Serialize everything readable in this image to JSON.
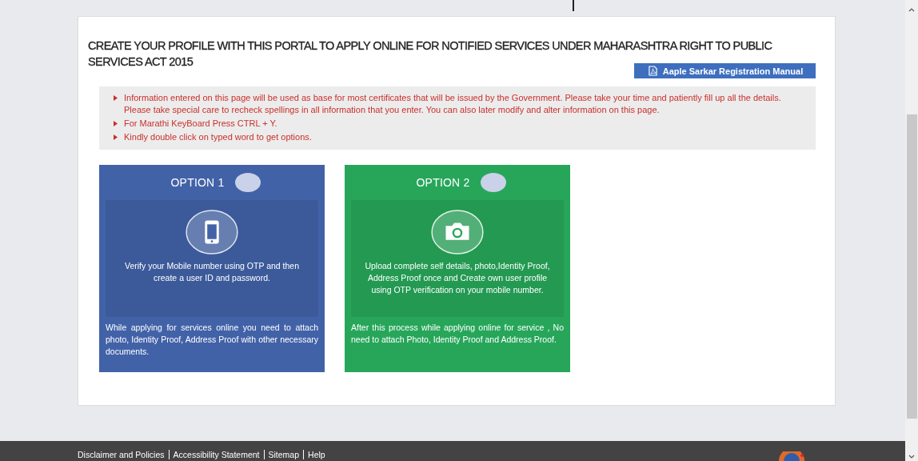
{
  "heading": "CREATE YOUR PROFILE WITH THIS PORTAL TO APPLY ONLINE FOR NOTIFIED SERVICES UNDER MAHARASHTRA RIGHT TO PUBLIC SERVICES ACT 2015",
  "manual_button": {
    "label": "Aaple Sarkar Registration Manual"
  },
  "notes": [
    "Information entered on this page will be used as base for most certificates that will be issued by the Government. Please take your time and patiently fill up all the details. Please take special care to recheck spellings in all information that you enter. You can also later modify and alter information on this page.",
    "For Marathi KeyBoard Press CTRL + Y.",
    "Kindly double click on typed word to get options."
  ],
  "options": [
    {
      "kind": "mobile",
      "title": "OPTION 1",
      "selected": false,
      "color": "#4262a8",
      "description": "Verify your Mobile number using OTP and then create a user ID and password.",
      "footnote": "While applying for services online you need to attach photo, Identity Proof, Address Proof with other necessary documents."
    },
    {
      "kind": "camera",
      "title": "OPTION 2",
      "selected": false,
      "color": "#27a65a",
      "description": "Upload complete self details, photo,Identity Proof, Address Proof once and Create own user profile using OTP verification on your mobile number.",
      "footnote": "After this process while applying online for service , No need to attach Photo, Identity Proof and Address Proof."
    }
  ],
  "footer_links": [
    "Disclaimer and Policies",
    "Accessibility Statement",
    "Sitemap",
    "Help"
  ]
}
